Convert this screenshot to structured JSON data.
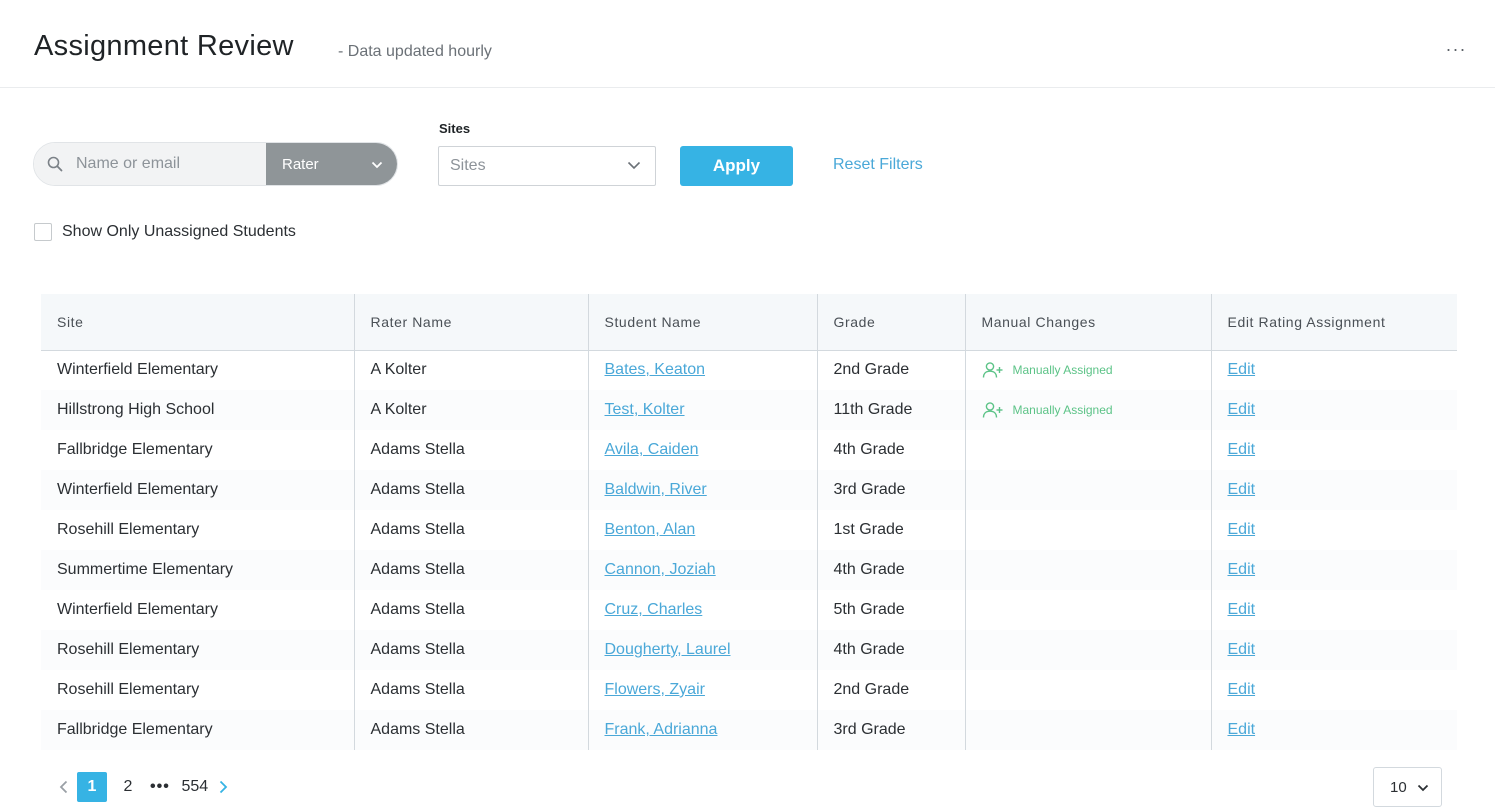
{
  "header": {
    "title": "Assignment Review",
    "subtitle": "- Data updated hourly",
    "more_label": "···"
  },
  "filters": {
    "search_placeholder": "Name or email",
    "search_type": "Rater",
    "sites_label": "Sites",
    "sites_placeholder": "Sites",
    "apply_label": "Apply",
    "reset_label": "Reset Filters",
    "unassigned_label": "Show Only Unassigned Students"
  },
  "table": {
    "columns": [
      "Site",
      "Rater Name",
      "Student Name",
      "Grade",
      "Manual Changes",
      "Edit Rating Assignment"
    ],
    "rows": [
      {
        "site": "Winterfield Elementary",
        "rater": "A Kolter",
        "student": "Bates, Keaton",
        "grade": "2nd Grade",
        "manual": "Manually Assigned",
        "edit": "Edit"
      },
      {
        "site": "Hillstrong High School",
        "rater": "A Kolter",
        "student": "Test, Kolter",
        "grade": "11th Grade",
        "manual": "Manually Assigned",
        "edit": "Edit"
      },
      {
        "site": "Fallbridge Elementary",
        "rater": "Adams Stella",
        "student": "Avila, Caiden",
        "grade": "4th Grade",
        "manual": "",
        "edit": "Edit"
      },
      {
        "site": "Winterfield Elementary",
        "rater": "Adams Stella",
        "student": "Baldwin, River",
        "grade": "3rd Grade",
        "manual": "",
        "edit": "Edit"
      },
      {
        "site": "Rosehill Elementary",
        "rater": "Adams Stella",
        "student": "Benton, Alan",
        "grade": "1st Grade",
        "manual": "",
        "edit": "Edit"
      },
      {
        "site": "Summertime Elementary",
        "rater": "Adams Stella",
        "student": "Cannon, Joziah",
        "grade": "4th Grade",
        "manual": "",
        "edit": "Edit"
      },
      {
        "site": "Winterfield Elementary",
        "rater": "Adams Stella",
        "student": "Cruz, Charles",
        "grade": "5th Grade",
        "manual": "",
        "edit": "Edit"
      },
      {
        "site": "Rosehill Elementary",
        "rater": "Adams Stella",
        "student": "Dougherty, Laurel",
        "grade": "4th Grade",
        "manual": "",
        "edit": "Edit"
      },
      {
        "site": "Rosehill Elementary",
        "rater": "Adams Stella",
        "student": "Flowers, Zyair",
        "grade": "2nd Grade",
        "manual": "",
        "edit": "Edit"
      },
      {
        "site": "Fallbridge Elementary",
        "rater": "Adams Stella",
        "student": "Frank, Adrianna",
        "grade": "3rd Grade",
        "manual": "",
        "edit": "Edit"
      }
    ]
  },
  "pagination": {
    "current": "1",
    "next_page": "2",
    "ellipsis": "•••",
    "last": "554",
    "per_page": "10"
  },
  "colors": {
    "accent": "#36b3e4",
    "link": "#4aa8d8",
    "manual_green": "#5cc387",
    "select_gray": "#8f9598"
  }
}
